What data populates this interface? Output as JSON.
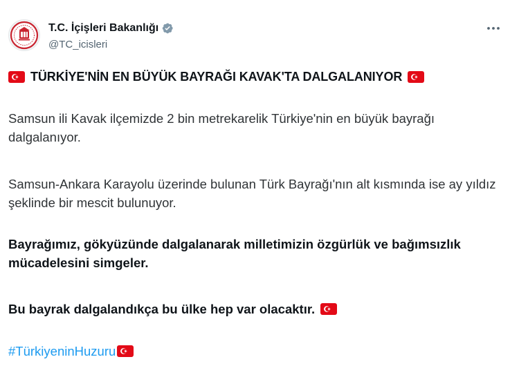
{
  "account": {
    "display_name": "T.C. İçişleri Bakanlığı",
    "handle": "@TC_icisleri",
    "verified_icon": "verified-badge-icon",
    "avatar_icon": "ministry-emblem-icon"
  },
  "menu": {
    "more_icon": "more-options-icon"
  },
  "tweet": {
    "headline": "TÜRKİYE'NİN EN BÜYÜK BAYRAĞI KAVAK'TA DALGALANIYOR",
    "paragraph1": "Samsun ili Kavak ilçemizde 2 bin metrekarelik Türkiye'nin en büyük bayrağı dalgalanıyor.",
    "paragraph2": "Samsun-Ankara Karayolu üzerinde bulunan Türk Bayrağı'nın alt kısmında ise ay yıldız şeklinde bir mescit bulunuyor.",
    "paragraph3": "Bayrağımız, gökyüzünde dalgalanarak milletimizin özgürlük ve bağımsızlık mücadelesini simgeler.",
    "paragraph4": "Bu bayrak dalgalandıkça bu ülke hep var olacaktır.",
    "hashtag": "#TürkiyeninHuzuru",
    "flag_icon": "turkish-flag-icon"
  },
  "colors": {
    "link": "#1d9bf0",
    "verified": "#829aab",
    "flag_red": "#e30a17",
    "secondary_text": "#536471"
  }
}
